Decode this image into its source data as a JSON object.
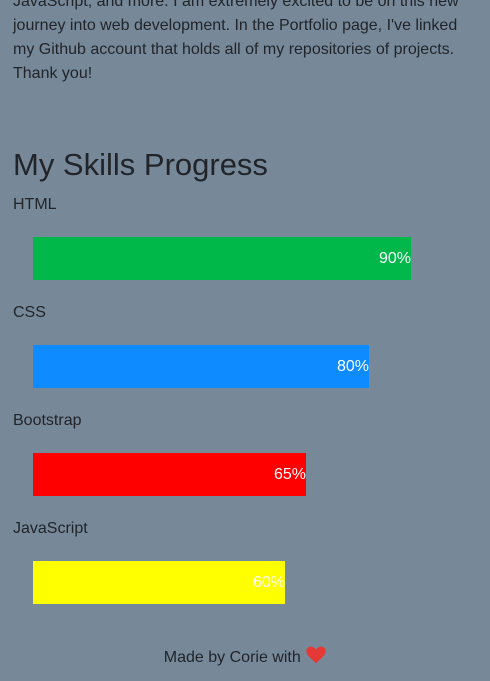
{
  "about": {
    "text": "JavaScript, and more. I am extremely excited to be on this new journey into web development. In the Portfolio page, I've linked my Github account that holds all of my repositories of projects. Thank you!"
  },
  "skills": {
    "title": "My Skills Progress",
    "items": [
      {
        "name": "HTML",
        "percent": 90,
        "label": "90%",
        "color": "#00b74a"
      },
      {
        "name": "CSS",
        "percent": 80,
        "label": "80%",
        "color": "#0d8bff"
      },
      {
        "name": "Bootstrap",
        "percent": 65,
        "label": "65%",
        "color": "#ff0000"
      },
      {
        "name": "JavaScript",
        "percent": 60,
        "label": "60%",
        "color": "#ffff00"
      }
    ]
  },
  "footer": {
    "text": "Made by Corie with",
    "icon": "heart-icon",
    "icon_color": "#e53935"
  }
}
